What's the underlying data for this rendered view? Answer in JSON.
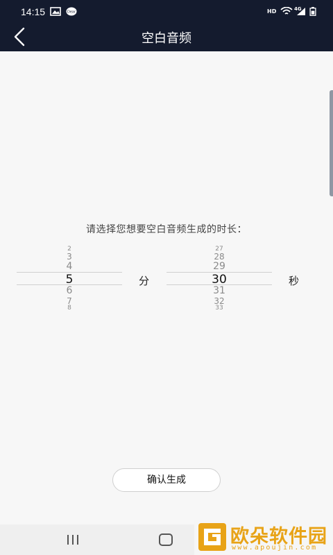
{
  "status_bar": {
    "time": "14:15",
    "hd_label": "HD",
    "network_label": "4G"
  },
  "header": {
    "title": "空白音频"
  },
  "prompt_text": "请选择您想要空白音频生成的时长：",
  "minutes_picker": {
    "items": [
      "2",
      "3",
      "4",
      "5",
      "6",
      "7",
      "8"
    ],
    "selected": "5",
    "unit": "分"
  },
  "seconds_picker": {
    "items": [
      "27",
      "28",
      "29",
      "30",
      "31",
      "32",
      "33"
    ],
    "selected": "30",
    "unit": "秒"
  },
  "confirm_button": "确认生成",
  "watermark": {
    "text": "欧朵软件园",
    "url": "www.apoujin.com"
  },
  "colors": {
    "header_bg": "#141b2e",
    "background": "#f7f7f7",
    "watermark": "#e8a317"
  }
}
